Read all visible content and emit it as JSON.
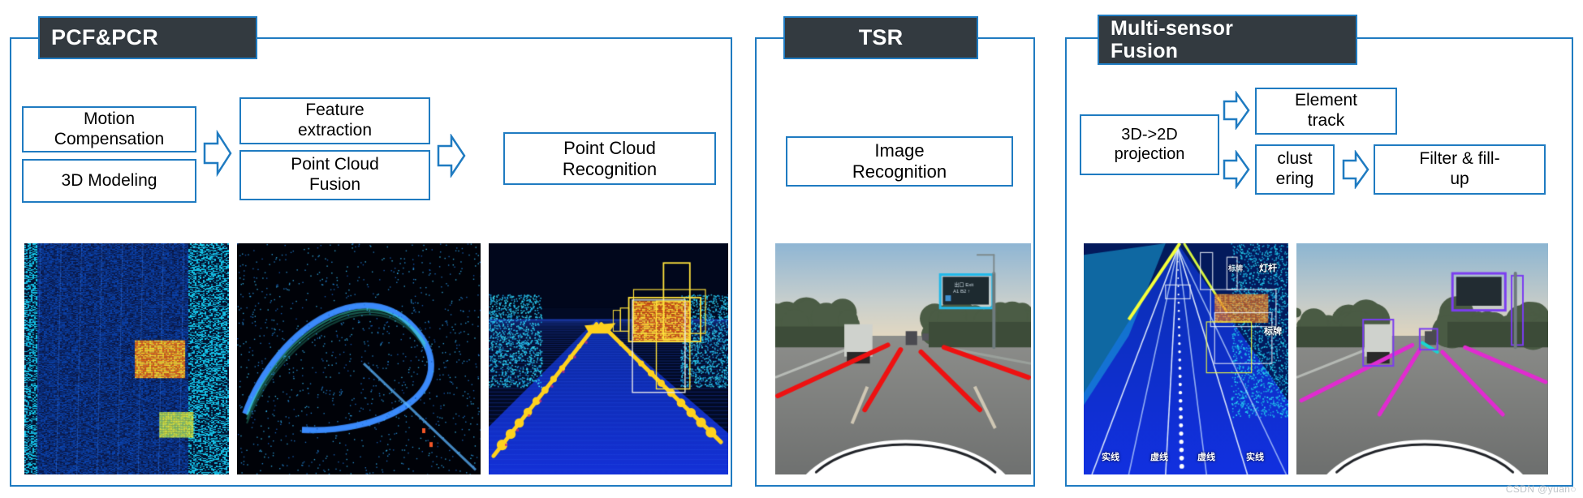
{
  "diagram": {
    "accent_color": "#1f7bc1",
    "title_bg_color": "#333a40",
    "title_text_color": "#ffffff",
    "box_text_color": "#000000"
  },
  "panels": [
    {
      "id": "pcf-pcr",
      "title": "PCF&PCR",
      "boxes": [
        {
          "id": "motion-compensation",
          "label": "Motion\nCompensation"
        },
        {
          "id": "3d-modeling",
          "label": "3D Modeling"
        },
        {
          "id": "feature-extraction",
          "label": "Feature\nextraction"
        },
        {
          "id": "point-cloud-fusion",
          "label": "Point Cloud\nFusion"
        },
        {
          "id": "point-cloud-recognition",
          "label": "Point Cloud\nRecognition"
        }
      ],
      "arrows": [
        {
          "id": "arrow-stage1-stage2"
        },
        {
          "id": "arrow-stage2-stage3"
        }
      ],
      "media": [
        {
          "id": "lidar-intensity-road",
          "alt": "lidar intensity map of a straight road"
        },
        {
          "id": "lidar-curved-highway",
          "alt": "lidar point cloud of a curved highway ramp"
        },
        {
          "id": "lidar-detection-boxes",
          "alt": "lidar road scene with yellow detection bounding boxes"
        }
      ]
    },
    {
      "id": "tsr",
      "title": "TSR",
      "boxes": [
        {
          "id": "image-recognition",
          "label": "Image\nRecognition"
        }
      ],
      "arrows": [],
      "media": [
        {
          "id": "camera-road-sign",
          "alt": "dashcam highway photo with detected overhead sign and red lane markings"
        }
      ]
    },
    {
      "id": "multi-sensor-fusion",
      "title": "Multi-sensor\nFusion",
      "boxes": [
        {
          "id": "projection-3d-2d",
          "label": "3D->2D\nprojection"
        },
        {
          "id": "element-track",
          "label": "Element\ntrack"
        },
        {
          "id": "clustering",
          "label": "clust\nering"
        },
        {
          "id": "filter-fill-up",
          "label": "Filter & fill-\nup"
        }
      ],
      "arrows": [
        {
          "id": "arrow-projection-element"
        },
        {
          "id": "arrow-projection-clustering"
        },
        {
          "id": "arrow-clustering-filter"
        }
      ],
      "media": [
        {
          "id": "fusion-lidar-labeled",
          "alt": "lidar lane scene with Chinese annotations"
        },
        {
          "id": "fusion-camera-boxes",
          "alt": "dashcam image with purple fused detection boxes"
        }
      ]
    }
  ],
  "annotations": {
    "lidar_labels": [
      {
        "text": "实线"
      },
      {
        "text": "虚线"
      },
      {
        "text": "虚线"
      },
      {
        "text": "实线"
      },
      {
        "text": "标牌"
      },
      {
        "text": "灯杆"
      },
      {
        "text": "标牌"
      }
    ]
  },
  "watermark": {
    "text": "CSDN @yuan○"
  }
}
